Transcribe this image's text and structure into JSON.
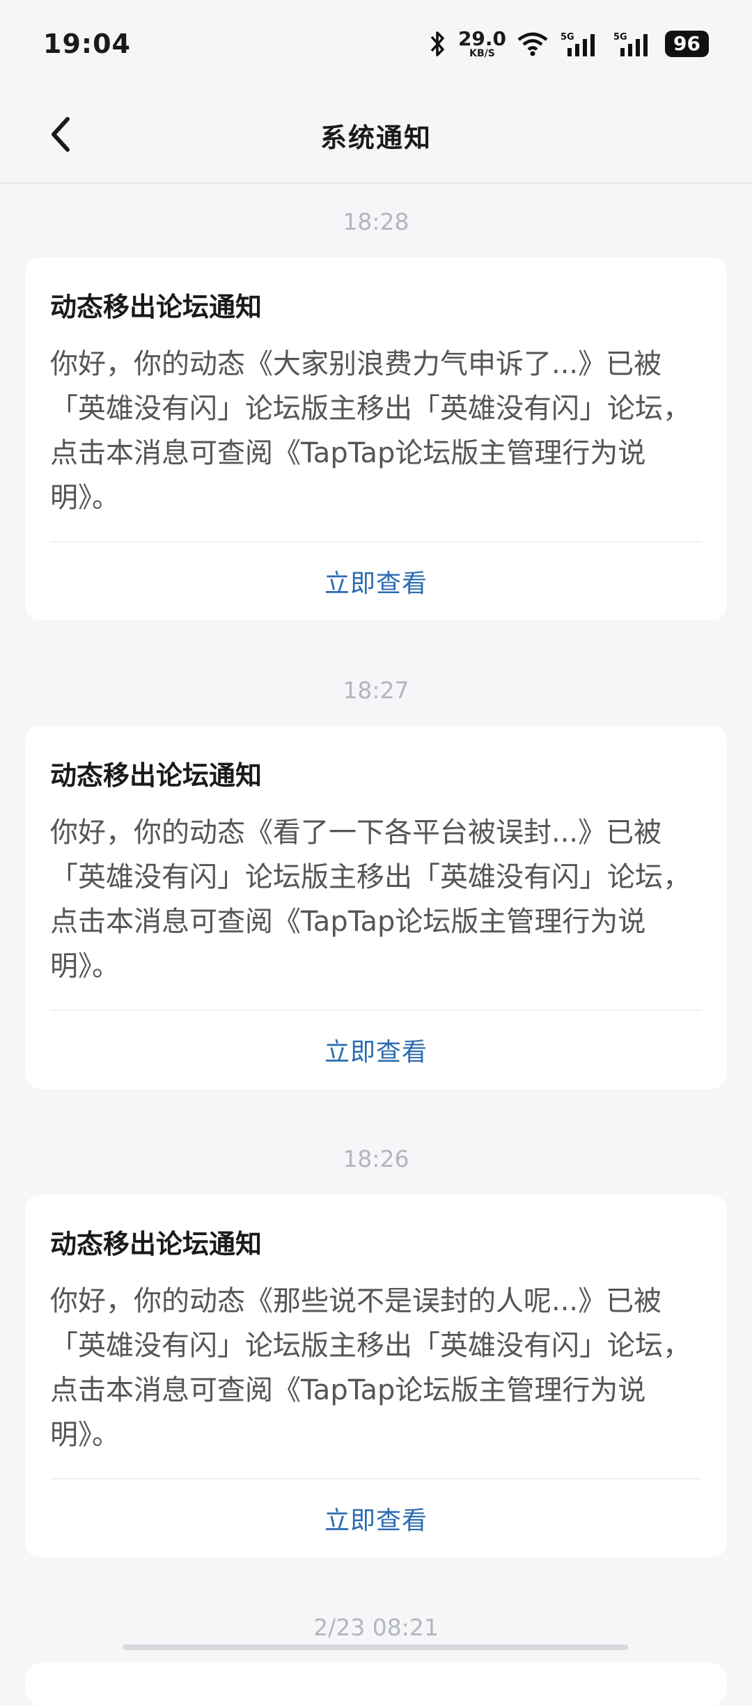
{
  "status_bar": {
    "time": "19:04",
    "net_speed": "29.0",
    "net_unit": "KB/S",
    "signal_1": "5G",
    "signal_2": "5G",
    "battery": "96"
  },
  "header": {
    "title": "系统通知"
  },
  "notifications": [
    {
      "time": "18:28",
      "title": "动态移出论坛通知",
      "body": "你好，你的动态《大家别浪费力气申诉了...》已被「英雄没有闪」论坛版主移出「英雄没有闪」论坛，点击本消息可查阅《TapTap论坛版主管理行为说明》。",
      "action": "立即查看"
    },
    {
      "time": "18:27",
      "title": "动态移出论坛通知",
      "body": "你好，你的动态《看了一下各平台被误封...》已被「英雄没有闪」论坛版主移出「英雄没有闪」论坛，点击本消息可查阅《TapTap论坛版主管理行为说明》。",
      "action": "立即查看"
    },
    {
      "time": "18:26",
      "title": "动态移出论坛通知",
      "body": "你好，你的动态《那些说不是误封的人呢...》已被「英雄没有闪」论坛版主移出「英雄没有闪」论坛，点击本消息可查阅《TapTap论坛版主管理行为说明》。",
      "action": "立即查看"
    }
  ],
  "next_time_label": "2/23  08:21",
  "colors": {
    "accent": "#2b6bb0",
    "background": "#f5f6f8",
    "card": "#ffffff"
  }
}
